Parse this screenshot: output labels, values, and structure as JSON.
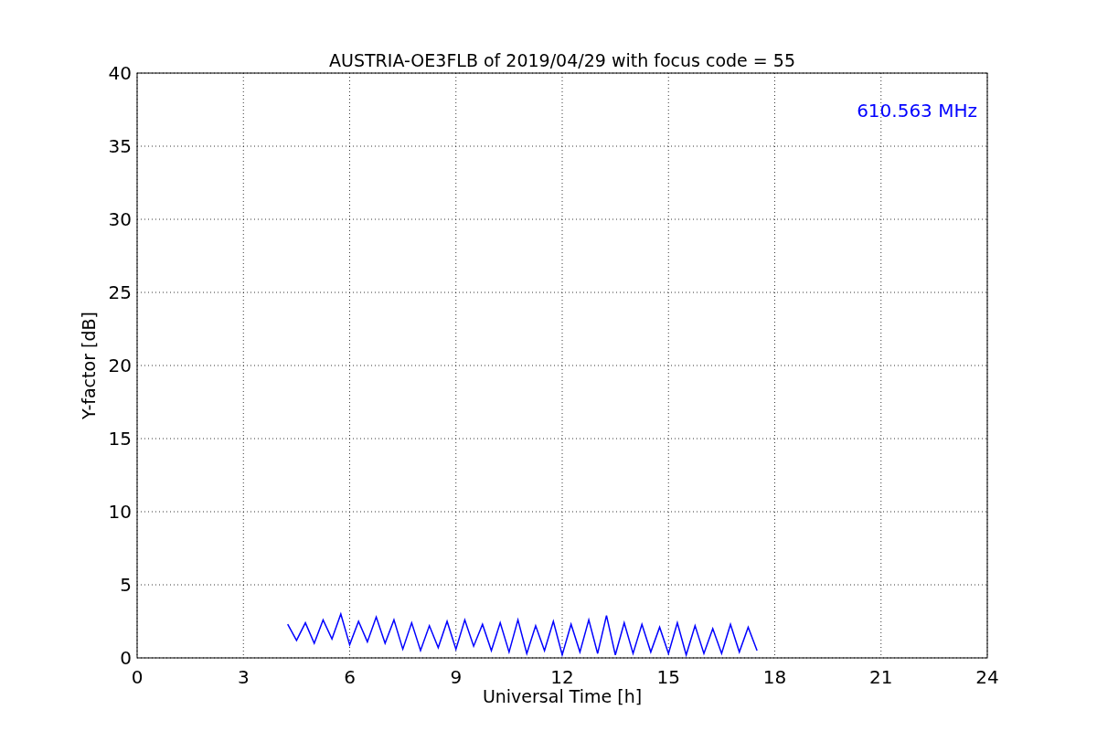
{
  "chart_data": {
    "type": "line",
    "title": "AUSTRIA-OE3FLB of 2019/04/29 with focus code = 55",
    "xlabel": "Universal Time [h]",
    "ylabel": "Y-factor [dB]",
    "x": [
      4.25,
      4.5,
      4.75,
      5,
      5.25,
      5.5,
      5.75,
      6,
      6.25,
      6.5,
      6.75,
      7,
      7.25,
      7.5,
      7.75,
      8,
      8.25,
      8.5,
      8.75,
      9,
      9.25,
      9.5,
      9.75,
      10,
      10.25,
      10.5,
      10.75,
      11,
      11.25,
      11.5,
      11.75,
      12,
      12.25,
      12.5,
      12.75,
      13,
      13.25,
      13.5,
      13.75,
      14,
      14.25,
      14.5,
      14.75,
      15,
      15.25,
      15.5,
      15.75,
      16,
      16.25,
      16.5,
      16.75,
      17,
      17.25,
      17.5
    ],
    "series": [
      {
        "name": "610.563 MHz",
        "color": "#0000ff",
        "values": [
          2.3,
          1.2,
          2.4,
          1.0,
          2.6,
          1.3,
          3.0,
          0.9,
          2.5,
          1.1,
          2.8,
          1.0,
          2.6,
          0.6,
          2.4,
          0.5,
          2.2,
          0.7,
          2.5,
          0.6,
          2.6,
          0.8,
          2.3,
          0.5,
          2.4,
          0.4,
          2.6,
          0.3,
          2.2,
          0.5,
          2.5,
          0.2,
          2.3,
          0.4,
          2.6,
          0.3,
          2.9,
          0.2,
          2.4,
          0.3,
          2.3,
          0.4,
          2.1,
          0.3,
          2.4,
          0.2,
          2.2,
          0.3,
          2.0,
          0.3,
          2.3,
          0.4,
          2.1,
          0.5
        ]
      }
    ],
    "xlim": [
      0,
      24
    ],
    "ylim": [
      0,
      40
    ],
    "xticks": [
      0,
      3,
      6,
      9,
      12,
      15,
      18,
      21,
      24
    ],
    "yticks": [
      0,
      5,
      10,
      15,
      20,
      25,
      30,
      35,
      40
    ],
    "grid": true
  }
}
